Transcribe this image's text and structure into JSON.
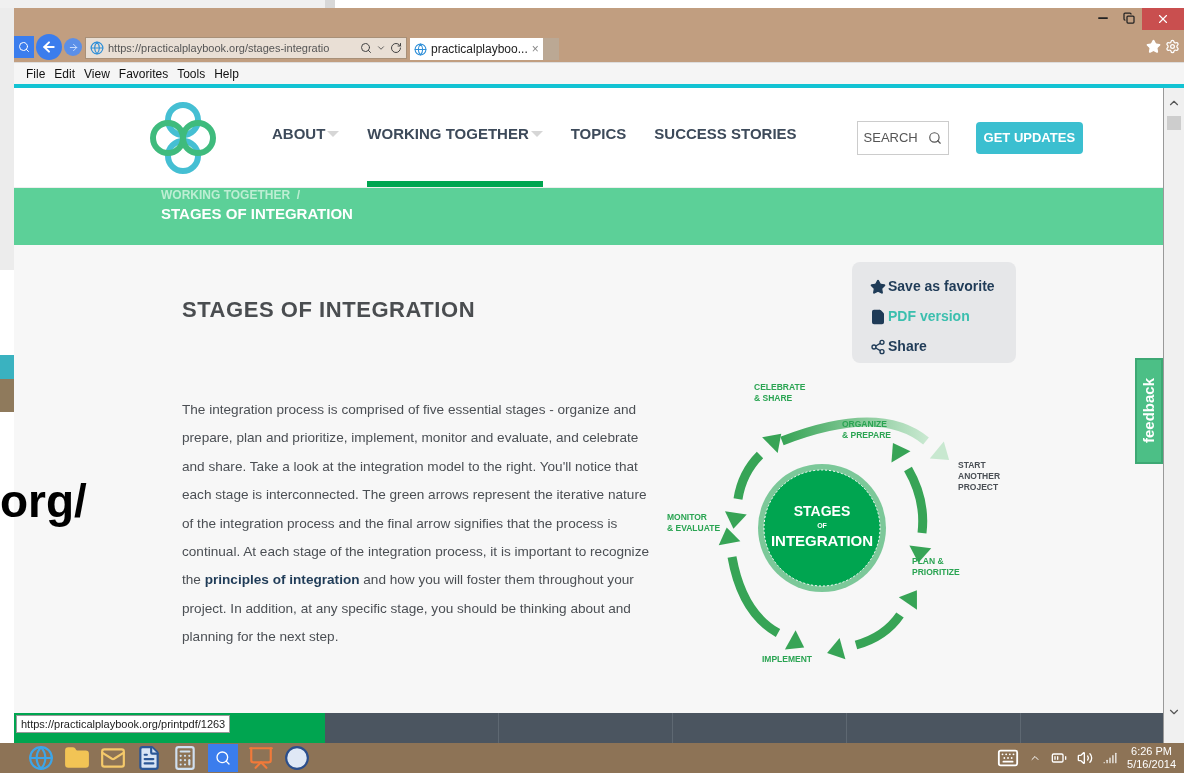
{
  "browser": {
    "address": "https://practicalplaybook.org/stages-integratio",
    "tab": {
      "title": "practicalplayboo...",
      "close": "×"
    },
    "menu": [
      "File",
      "Edit",
      "View",
      "Favorites",
      "Tools",
      "Help"
    ]
  },
  "background_window": {
    "text": "org/"
  },
  "site": {
    "nav": [
      {
        "label": "ABOUT",
        "has_menu": true,
        "selected": false
      },
      {
        "label": "WORKING TOGETHER",
        "has_menu": true,
        "selected": true
      },
      {
        "label": "TOPICS",
        "has_menu": false,
        "selected": false
      },
      {
        "label": "SUCCESS STORIES",
        "has_menu": false,
        "selected": false
      }
    ],
    "search": {
      "placeholder": "SEARCH"
    },
    "updates_button": "GET UPDATES",
    "breadcrumb": {
      "parent": "WORKING TOGETHER  /",
      "current": "STAGES OF INTEGRATION"
    }
  },
  "article": {
    "title": "STAGES OF INTEGRATION",
    "body": {
      "before": "The integration process is comprised of five essential stages - organize and prepare, plan and prioritize, implement, monitor and evaluate, and celebrate and share. Take a look at the integration model to the right. You'll notice that each stage is interconnected. The green arrows represent the iterative nature of the integration process and the final arrow signifies that the process is continual. At each stage of the integration process, it is important to recognize the ",
      "link": "principles of integration",
      "after": " and how you will foster them throughout your project. In addition, at any specific stage, you should be thinking about and planning for the next step."
    }
  },
  "actions": [
    {
      "kind": "favorite",
      "label": "Save as favorite",
      "color": "#1f3b57"
    },
    {
      "kind": "pdf",
      "label": "PDF version",
      "color": "#3bbfae"
    },
    {
      "kind": "share",
      "label": "Share",
      "color": "#1f3b57"
    }
  ],
  "diagram": {
    "center": [
      "STAGES",
      "OF",
      "INTEGRATION"
    ],
    "labels": [
      {
        "kind": "stage",
        "lines": [
          "CELEBRATE",
          "& SHARE"
        ]
      },
      {
        "kind": "stage",
        "lines": [
          "ORGANIZE",
          "& PREPARE"
        ]
      },
      {
        "kind": "exit",
        "lines": [
          "START",
          "ANOTHER",
          "PROJECT"
        ]
      },
      {
        "kind": "stage",
        "lines": [
          "MONITOR",
          "& EVALUATE"
        ]
      },
      {
        "kind": "stage",
        "lines": [
          "PLAN &",
          "PRIORITIZE"
        ]
      },
      {
        "kind": "stage",
        "lines": [
          "IMPLEMENT"
        ]
      }
    ]
  },
  "feedback_tab": "feedback",
  "status_url": "https://practicalplaybook.org/printpdf/1263",
  "taskbar": {
    "time": "6:26 PM",
    "date": "5/16/2014"
  }
}
